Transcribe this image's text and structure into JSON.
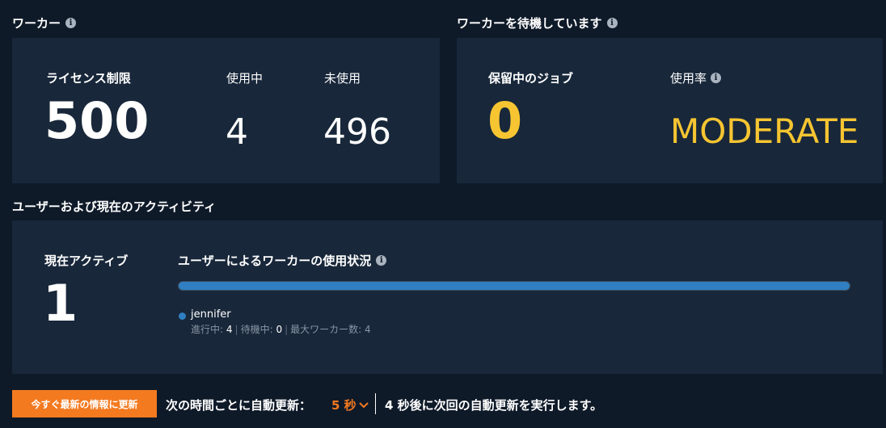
{
  "workers": {
    "title": "ワーカー",
    "license_label": "ライセンス制限",
    "license_value": "500",
    "in_use_label": "使用中",
    "in_use_value": "4",
    "unused_label": "未使用",
    "unused_value": "496"
  },
  "waiting": {
    "title": "ワーカーを待機しています",
    "pending_label": "保留中のジョブ",
    "pending_value": "0",
    "usage_label": "使用率",
    "usage_value": "MODERATE"
  },
  "activity": {
    "title": "ユーザーおよび現在のアクティビティ",
    "active_label": "現在アクティブ",
    "active_value": "1",
    "usage_title": "ユーザーによるワーカーの使用状況",
    "bar_fraction": 1.0,
    "users": [
      {
        "name": "jennifer",
        "running_label": "進行中:",
        "running_value": "4",
        "waiting_label": "待機中:",
        "waiting_value": "0",
        "max_label": "最大ワーカー数:",
        "max_value": "4"
      }
    ]
  },
  "footer": {
    "refresh_button": "今すぐ最新の情報に更新",
    "auto_refresh_label": "次の時間ごとに自動更新：",
    "interval": "5 秒",
    "next_refresh": "4 秒後に次回の自動更新を実行します。"
  },
  "colors": {
    "background": "#0f1a29",
    "panel": "#18273a",
    "accent_yellow": "#f7c531",
    "accent_orange": "#f47a20",
    "bar_blue": "#2f7fc2"
  },
  "icons": [
    "info-icon",
    "chevron-down-icon",
    "user-dot-icon"
  ]
}
